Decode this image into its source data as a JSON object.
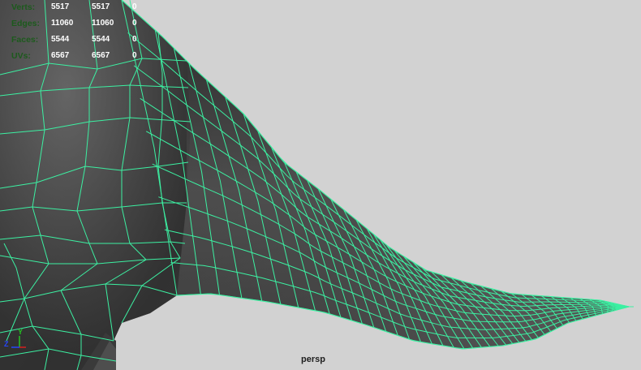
{
  "viewport": {
    "camera_label": "persp",
    "background_color": "#d2d2d2",
    "wireframe_color": "#3cf0a2"
  },
  "heads_up_display": {
    "rows": [
      {
        "label": "Verts:",
        "v1": "5517",
        "v2": "5517",
        "v3": "0"
      },
      {
        "label": "Edges:",
        "v1": "11060",
        "v2": "11060",
        "v3": "0"
      },
      {
        "label": "Faces:",
        "v1": "5544",
        "v2": "5544",
        "v3": "0"
      },
      {
        "label": "UVs:",
        "v1": "6567",
        "v2": "6567",
        "v3": "0"
      }
    ],
    "label_color": "#1d5a1d",
    "value_color": "#ffffff"
  },
  "axis_indicator": {
    "y_label": "Y",
    "z_label": "Z",
    "icon": "xyz-axis-gizmo-icon"
  }
}
